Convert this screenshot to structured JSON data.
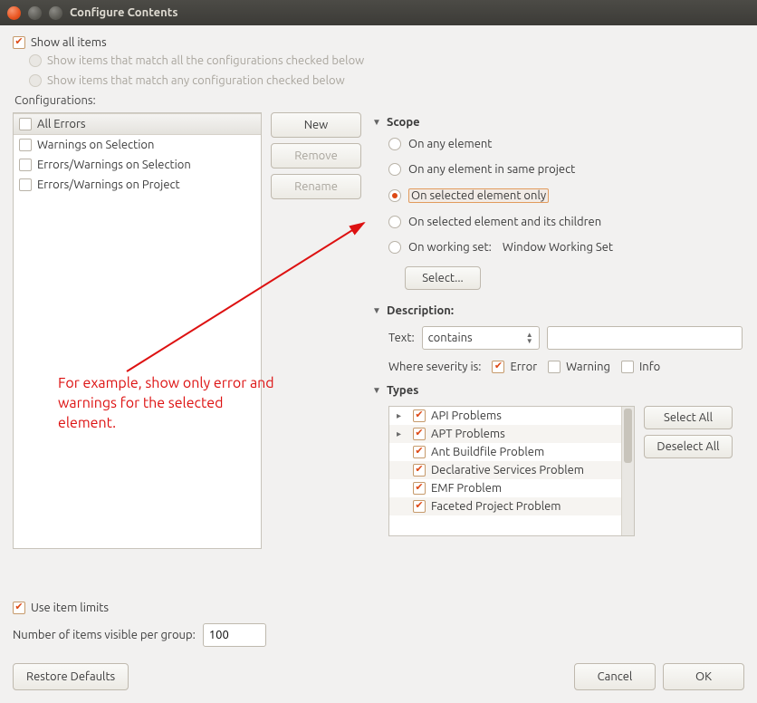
{
  "window": {
    "title": "Configure Contents"
  },
  "top": {
    "show_all": "Show all items",
    "match_all": "Show items that match all the configurations checked below",
    "match_any": "Show items that match any configuration checked below",
    "configs_label": "Configurations:"
  },
  "configs": {
    "items": [
      {
        "label": "All Errors",
        "selected": true,
        "checked": false
      },
      {
        "label": "Warnings on Selection",
        "selected": false,
        "checked": false
      },
      {
        "label": "Errors/Warnings on Selection",
        "selected": false,
        "checked": false
      },
      {
        "label": "Errors/Warnings on Project",
        "selected": false,
        "checked": false
      }
    ],
    "new_btn": "New",
    "remove_btn": "Remove",
    "rename_btn": "Rename"
  },
  "scope": {
    "header": "Scope",
    "any_element": "On any element",
    "same_project": "On any element in same project",
    "selected_only": "On selected element only",
    "selected_children": "On selected element and its children",
    "working_set": "On working set:",
    "working_set_name": "Window Working Set",
    "select_btn": "Select..."
  },
  "description": {
    "header": "Description:",
    "text_label": "Text:",
    "text_mode": "contains",
    "text_value": ""
  },
  "severity": {
    "label": "Where severity is:",
    "error": "Error",
    "warning": "Warning",
    "info": "Info"
  },
  "types": {
    "header": "Types",
    "select_all": "Select All",
    "deselect_all": "Deselect All",
    "items": [
      {
        "label": "API Problems",
        "expandable": true
      },
      {
        "label": "APT Problems",
        "expandable": true
      },
      {
        "label": "Ant Buildfile Problem",
        "expandable": false
      },
      {
        "label": "Declarative Services Problem",
        "expandable": false
      },
      {
        "label": "EMF Problem",
        "expandable": false
      },
      {
        "label": "Faceted Project Problem",
        "expandable": false
      }
    ]
  },
  "annotation": {
    "text": "For example, show only error and warnings for the selected element."
  },
  "limits": {
    "use_limits": "Use item limits",
    "num_label": "Number of items visible per group:",
    "num_value": "100"
  },
  "footer": {
    "restore": "Restore Defaults",
    "cancel": "Cancel",
    "ok": "OK"
  }
}
